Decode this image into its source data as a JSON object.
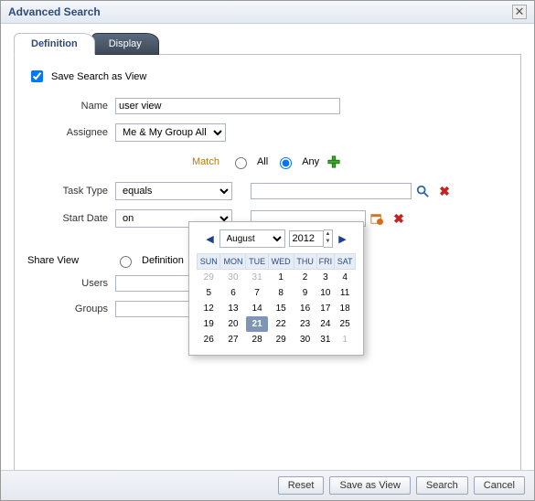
{
  "title": "Advanced Search",
  "tabs": {
    "definition": "Definition",
    "display": "Display"
  },
  "save_as_view_label": "Save Search as View",
  "save_as_view_checked": true,
  "name_label": "Name",
  "name_value": "user view",
  "assignee_label": "Assignee",
  "assignee_value": "Me & My Group All",
  "match": {
    "label": "Match",
    "all": "All",
    "any": "Any",
    "selected": "any"
  },
  "criteria": [
    {
      "field_label": "Task Type",
      "operator": "equals",
      "value": ""
    },
    {
      "field_label": "Start Date",
      "operator": "on",
      "value": ""
    }
  ],
  "share": {
    "label": "Share View",
    "definition_label": "Definition",
    "users_label": "Users",
    "groups_label": "Groups",
    "users_value": "",
    "groups_value": ""
  },
  "buttons": {
    "reset": "Reset",
    "save_as_view": "Save as View",
    "search": "Search",
    "cancel": "Cancel"
  },
  "datepicker": {
    "month": "August",
    "year": "2012",
    "dow": [
      "SUN",
      "MON",
      "TUE",
      "WED",
      "THU",
      "FRI",
      "SAT"
    ],
    "weeks": [
      [
        {
          "d": 29,
          "o": true
        },
        {
          "d": 30,
          "o": true
        },
        {
          "d": 31,
          "o": true
        },
        {
          "d": 1
        },
        {
          "d": 2
        },
        {
          "d": 3
        },
        {
          "d": 4
        }
      ],
      [
        {
          "d": 5
        },
        {
          "d": 6
        },
        {
          "d": 7
        },
        {
          "d": 8
        },
        {
          "d": 9
        },
        {
          "d": 10
        },
        {
          "d": 11
        }
      ],
      [
        {
          "d": 12
        },
        {
          "d": 13
        },
        {
          "d": 14
        },
        {
          "d": 15
        },
        {
          "d": 16
        },
        {
          "d": 17
        },
        {
          "d": 18
        }
      ],
      [
        {
          "d": 19
        },
        {
          "d": 20
        },
        {
          "d": 21,
          "sel": true
        },
        {
          "d": 22
        },
        {
          "d": 23
        },
        {
          "d": 24
        },
        {
          "d": 25
        }
      ],
      [
        {
          "d": 26
        },
        {
          "d": 27
        },
        {
          "d": 28
        },
        {
          "d": 29
        },
        {
          "d": 30
        },
        {
          "d": 31
        },
        {
          "d": 1,
          "o": true
        }
      ]
    ]
  }
}
